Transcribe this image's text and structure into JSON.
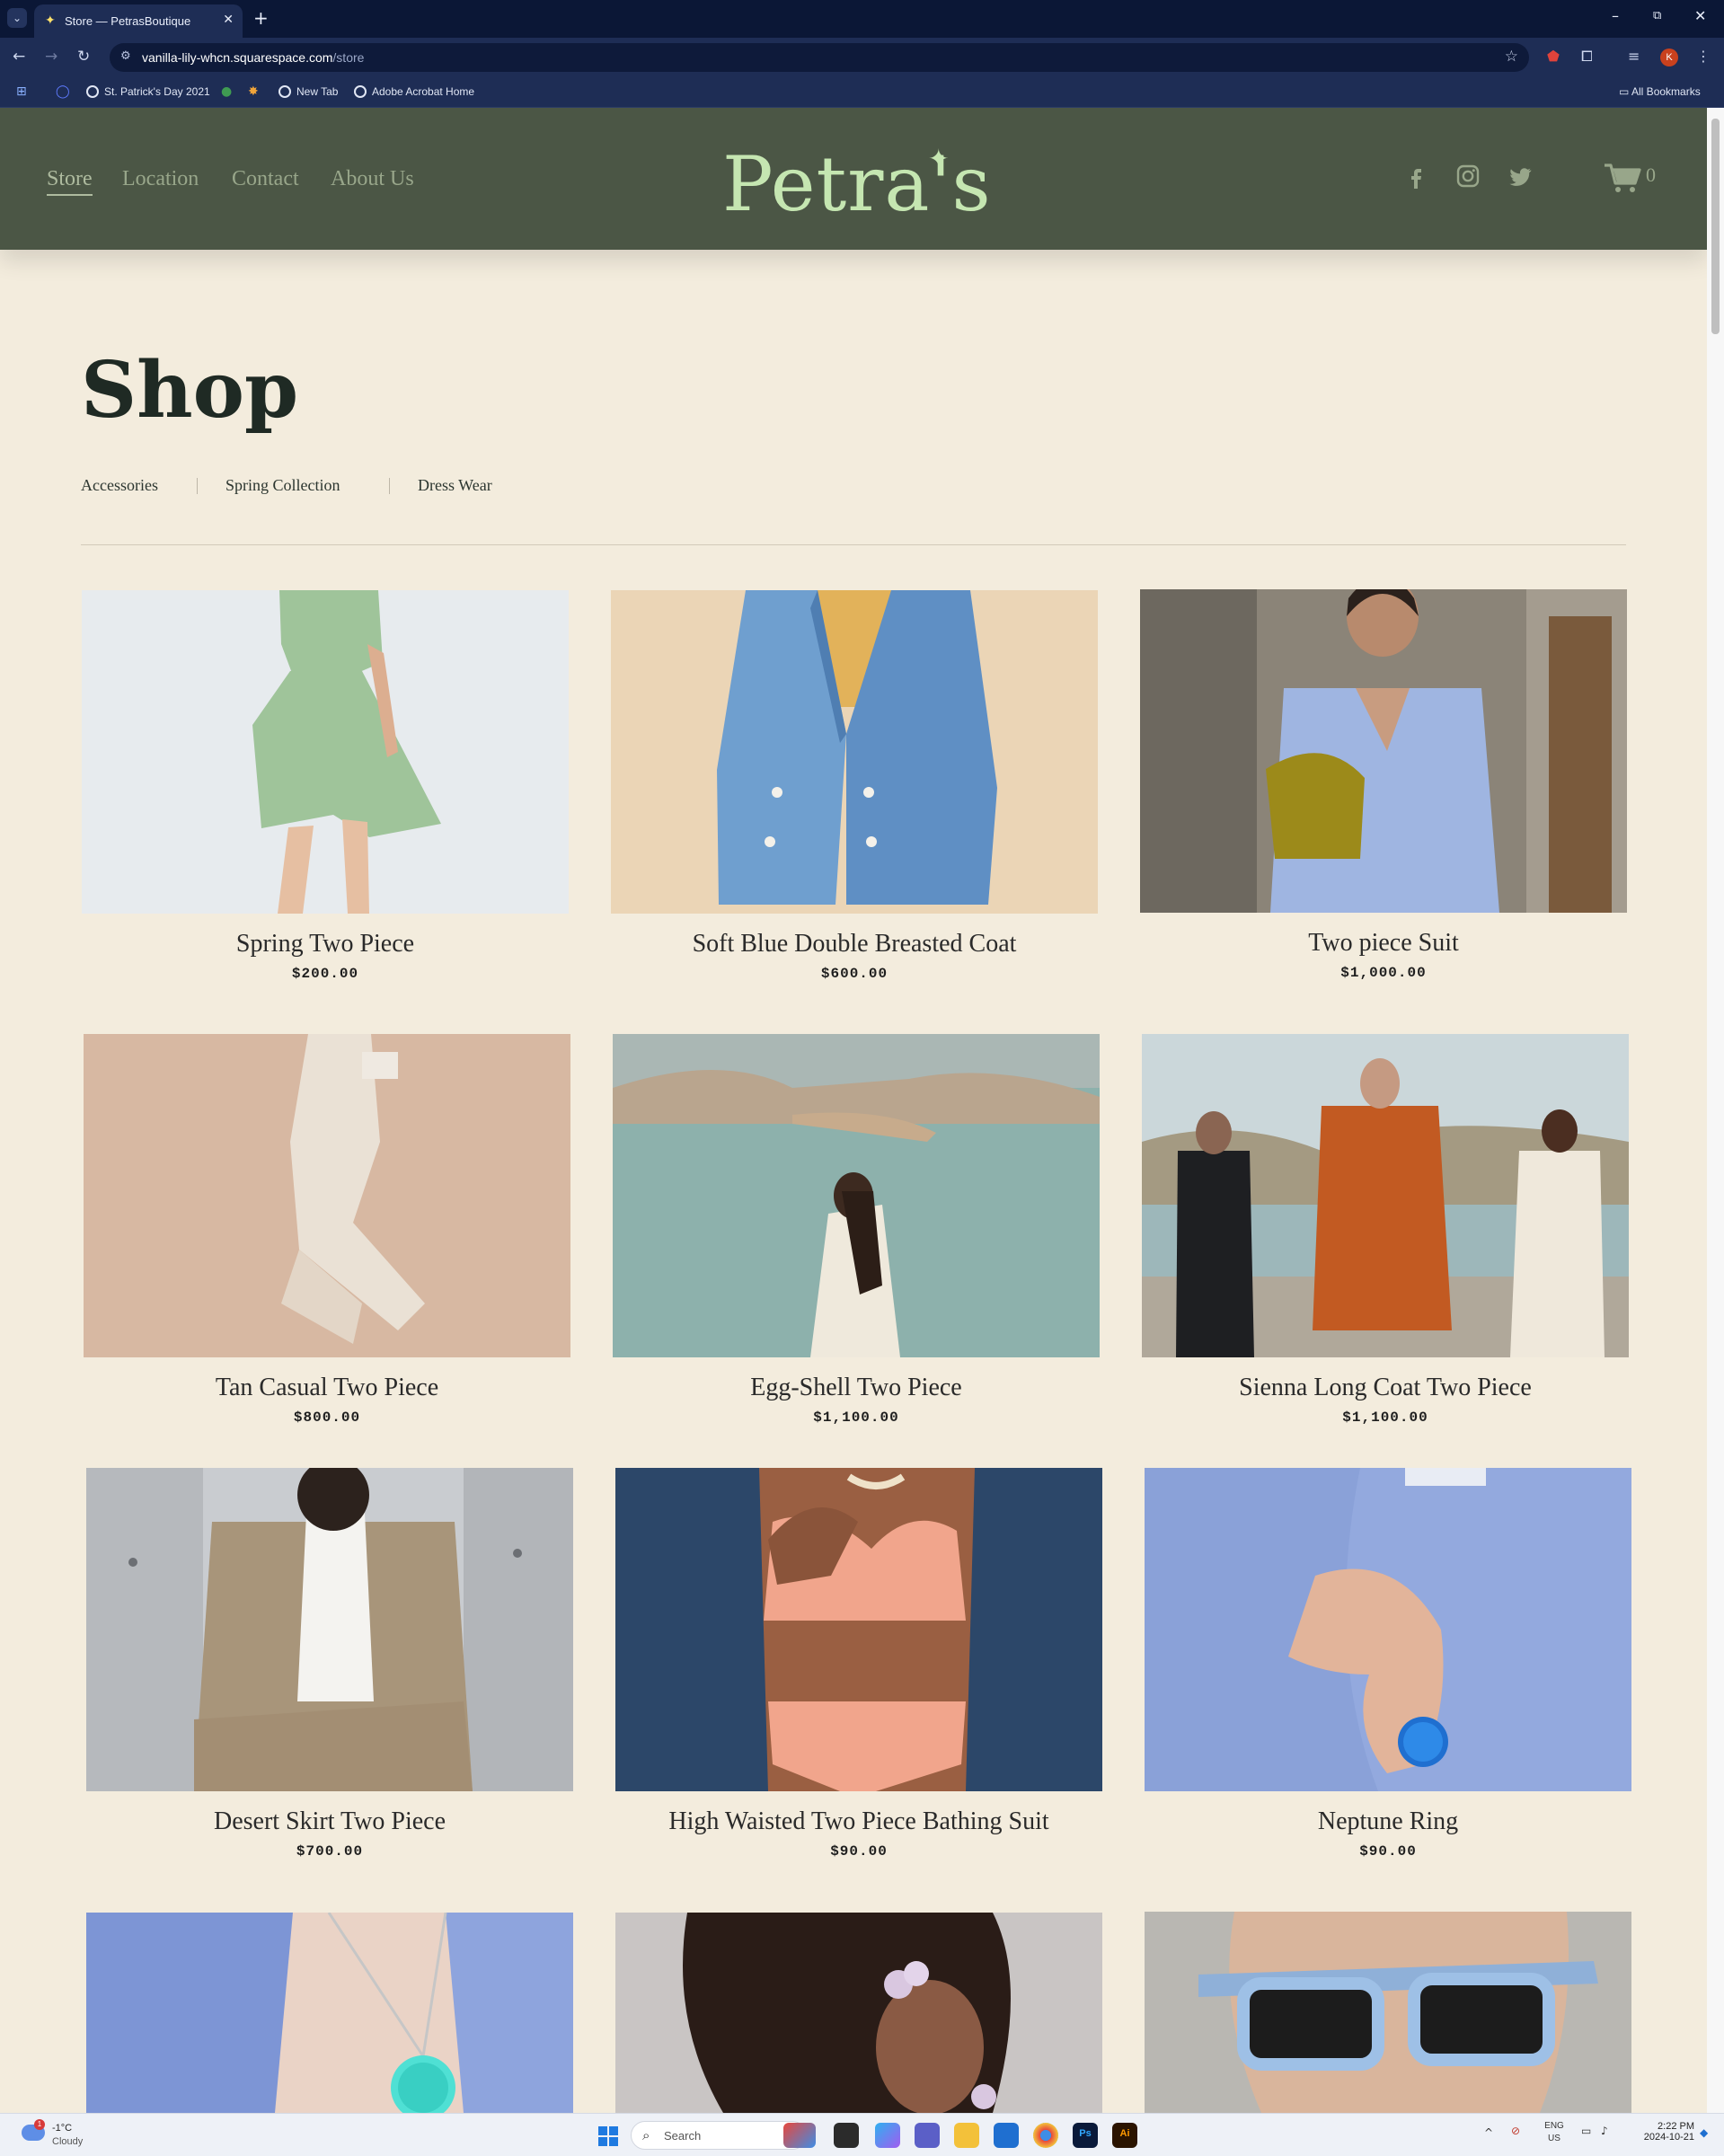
{
  "browser": {
    "tab_title": "Store — PetrasBoutique",
    "url_host": "vanilla-lily-whcn.squarespace.com",
    "url_path": "/store",
    "bookmarks": [
      "St. Patrick's Day 2021",
      "New Tab",
      "Adobe Acrobat Home"
    ],
    "all_bookmarks": "All Bookmarks",
    "profile_initial": "K",
    "icons": [
      "tab-menu-icon",
      "close-icon",
      "plus-icon",
      "minimize-icon",
      "restore-icon",
      "back-icon",
      "forward-icon",
      "reload-icon",
      "site-info-icon",
      "star-icon",
      "acrobat-icon",
      "extensions-icon",
      "media-icon",
      "more-icon",
      "apps-icon",
      "folder-icon"
    ]
  },
  "site": {
    "nav": [
      "Store",
      "Location",
      "Contact",
      "About Us"
    ],
    "logo": "Petra's",
    "cart_count": "0",
    "social_icons": [
      "facebook-icon",
      "instagram-icon",
      "twitter-icon",
      "cart-icon"
    ],
    "colors": {
      "header_bg": "#4b5645",
      "logo": "#c5e6b1",
      "nav": "#98a68a",
      "page_bg": "#f3ecdd"
    }
  },
  "shop": {
    "title": "Shop",
    "categories": [
      "Accessories",
      "Spring Collection",
      "Dress Wear"
    ],
    "products": [
      {
        "name": "Spring Two Piece",
        "price": "$200.00"
      },
      {
        "name": "Soft Blue Double Breasted Coat",
        "price": "$600.00"
      },
      {
        "name": "Two piece Suit",
        "price": "$1,000.00"
      },
      {
        "name": "Tan Casual Two Piece",
        "price": "$800.00"
      },
      {
        "name": "Egg-Shell Two Piece",
        "price": "$1,100.00"
      },
      {
        "name": "Sienna Long Coat Two Piece",
        "price": "$1,100.00"
      },
      {
        "name": "Desert Skirt Two Piece",
        "price": "$700.00"
      },
      {
        "name": "High Waisted Two Piece Bathing Suit",
        "price": "$90.00"
      },
      {
        "name": "Neptune Ring",
        "price": "$90.00"
      }
    ]
  },
  "taskbar": {
    "weather_temp": "-1°C",
    "weather_cond": "Cloudy",
    "weather_badge": "1",
    "search_placeholder": "Search",
    "lang": "ENG",
    "region": "US",
    "time": "2:22 PM",
    "date": "2024-10-21",
    "apps": [
      "Ps",
      "Ai"
    ]
  }
}
